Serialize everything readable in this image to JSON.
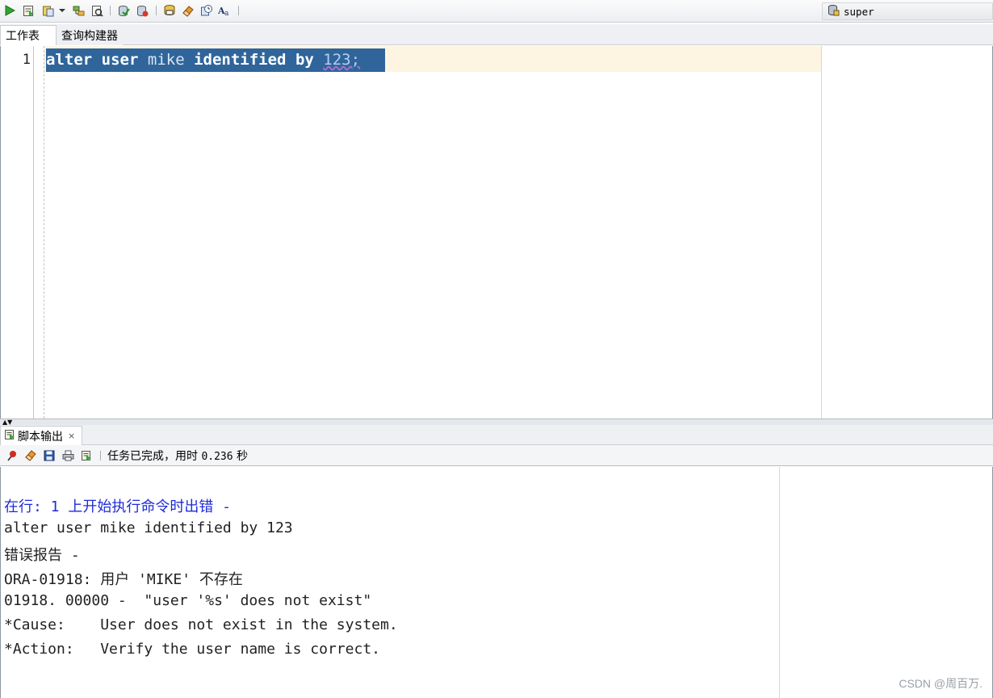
{
  "toolbar": {
    "buttons": [
      "run-statement",
      "run-script",
      "autotrace",
      "explain-plan",
      "sql-tuning",
      "commit",
      "rollback",
      "unshared-worksheet",
      "clear",
      "sql-history",
      "format"
    ],
    "connection": "super"
  },
  "tabs": [
    {
      "label": "工作表",
      "active": true
    },
    {
      "label": "查询构建器",
      "active": false
    }
  ],
  "editor": {
    "line_number": "1",
    "tokens": {
      "t1": "alter",
      "t2": "user",
      "t3": "mike",
      "t4": "identified",
      "t5": "by",
      "t6": "123;"
    },
    "selection_color": "#2f659a",
    "current_line_color": "#fdf5e2"
  },
  "output_panel": {
    "tab_label": "脚本输出",
    "tab_close": "×",
    "status_prefix": "任务已完成，用时",
    "status_time": "0.236",
    "status_unit": "秒",
    "lines": [
      {
        "text": "在行: 1 上开始执行命令时出错 -",
        "style": "blue"
      },
      {
        "text": "alter user mike identified by 123",
        "style": "normal"
      },
      {
        "text": "错误报告 -",
        "style": "normal"
      },
      {
        "text": "ORA-01918: 用户 'MIKE' 不存在",
        "style": "normal"
      },
      {
        "text": "01918. 00000 -  \"user '%s' does not exist\"",
        "style": "normal"
      },
      {
        "text": "*Cause:    User does not exist in the system.",
        "style": "normal"
      },
      {
        "text": "*Action:   Verify the user name is correct.",
        "style": "normal"
      }
    ]
  },
  "watermark": "CSDN @周百万."
}
